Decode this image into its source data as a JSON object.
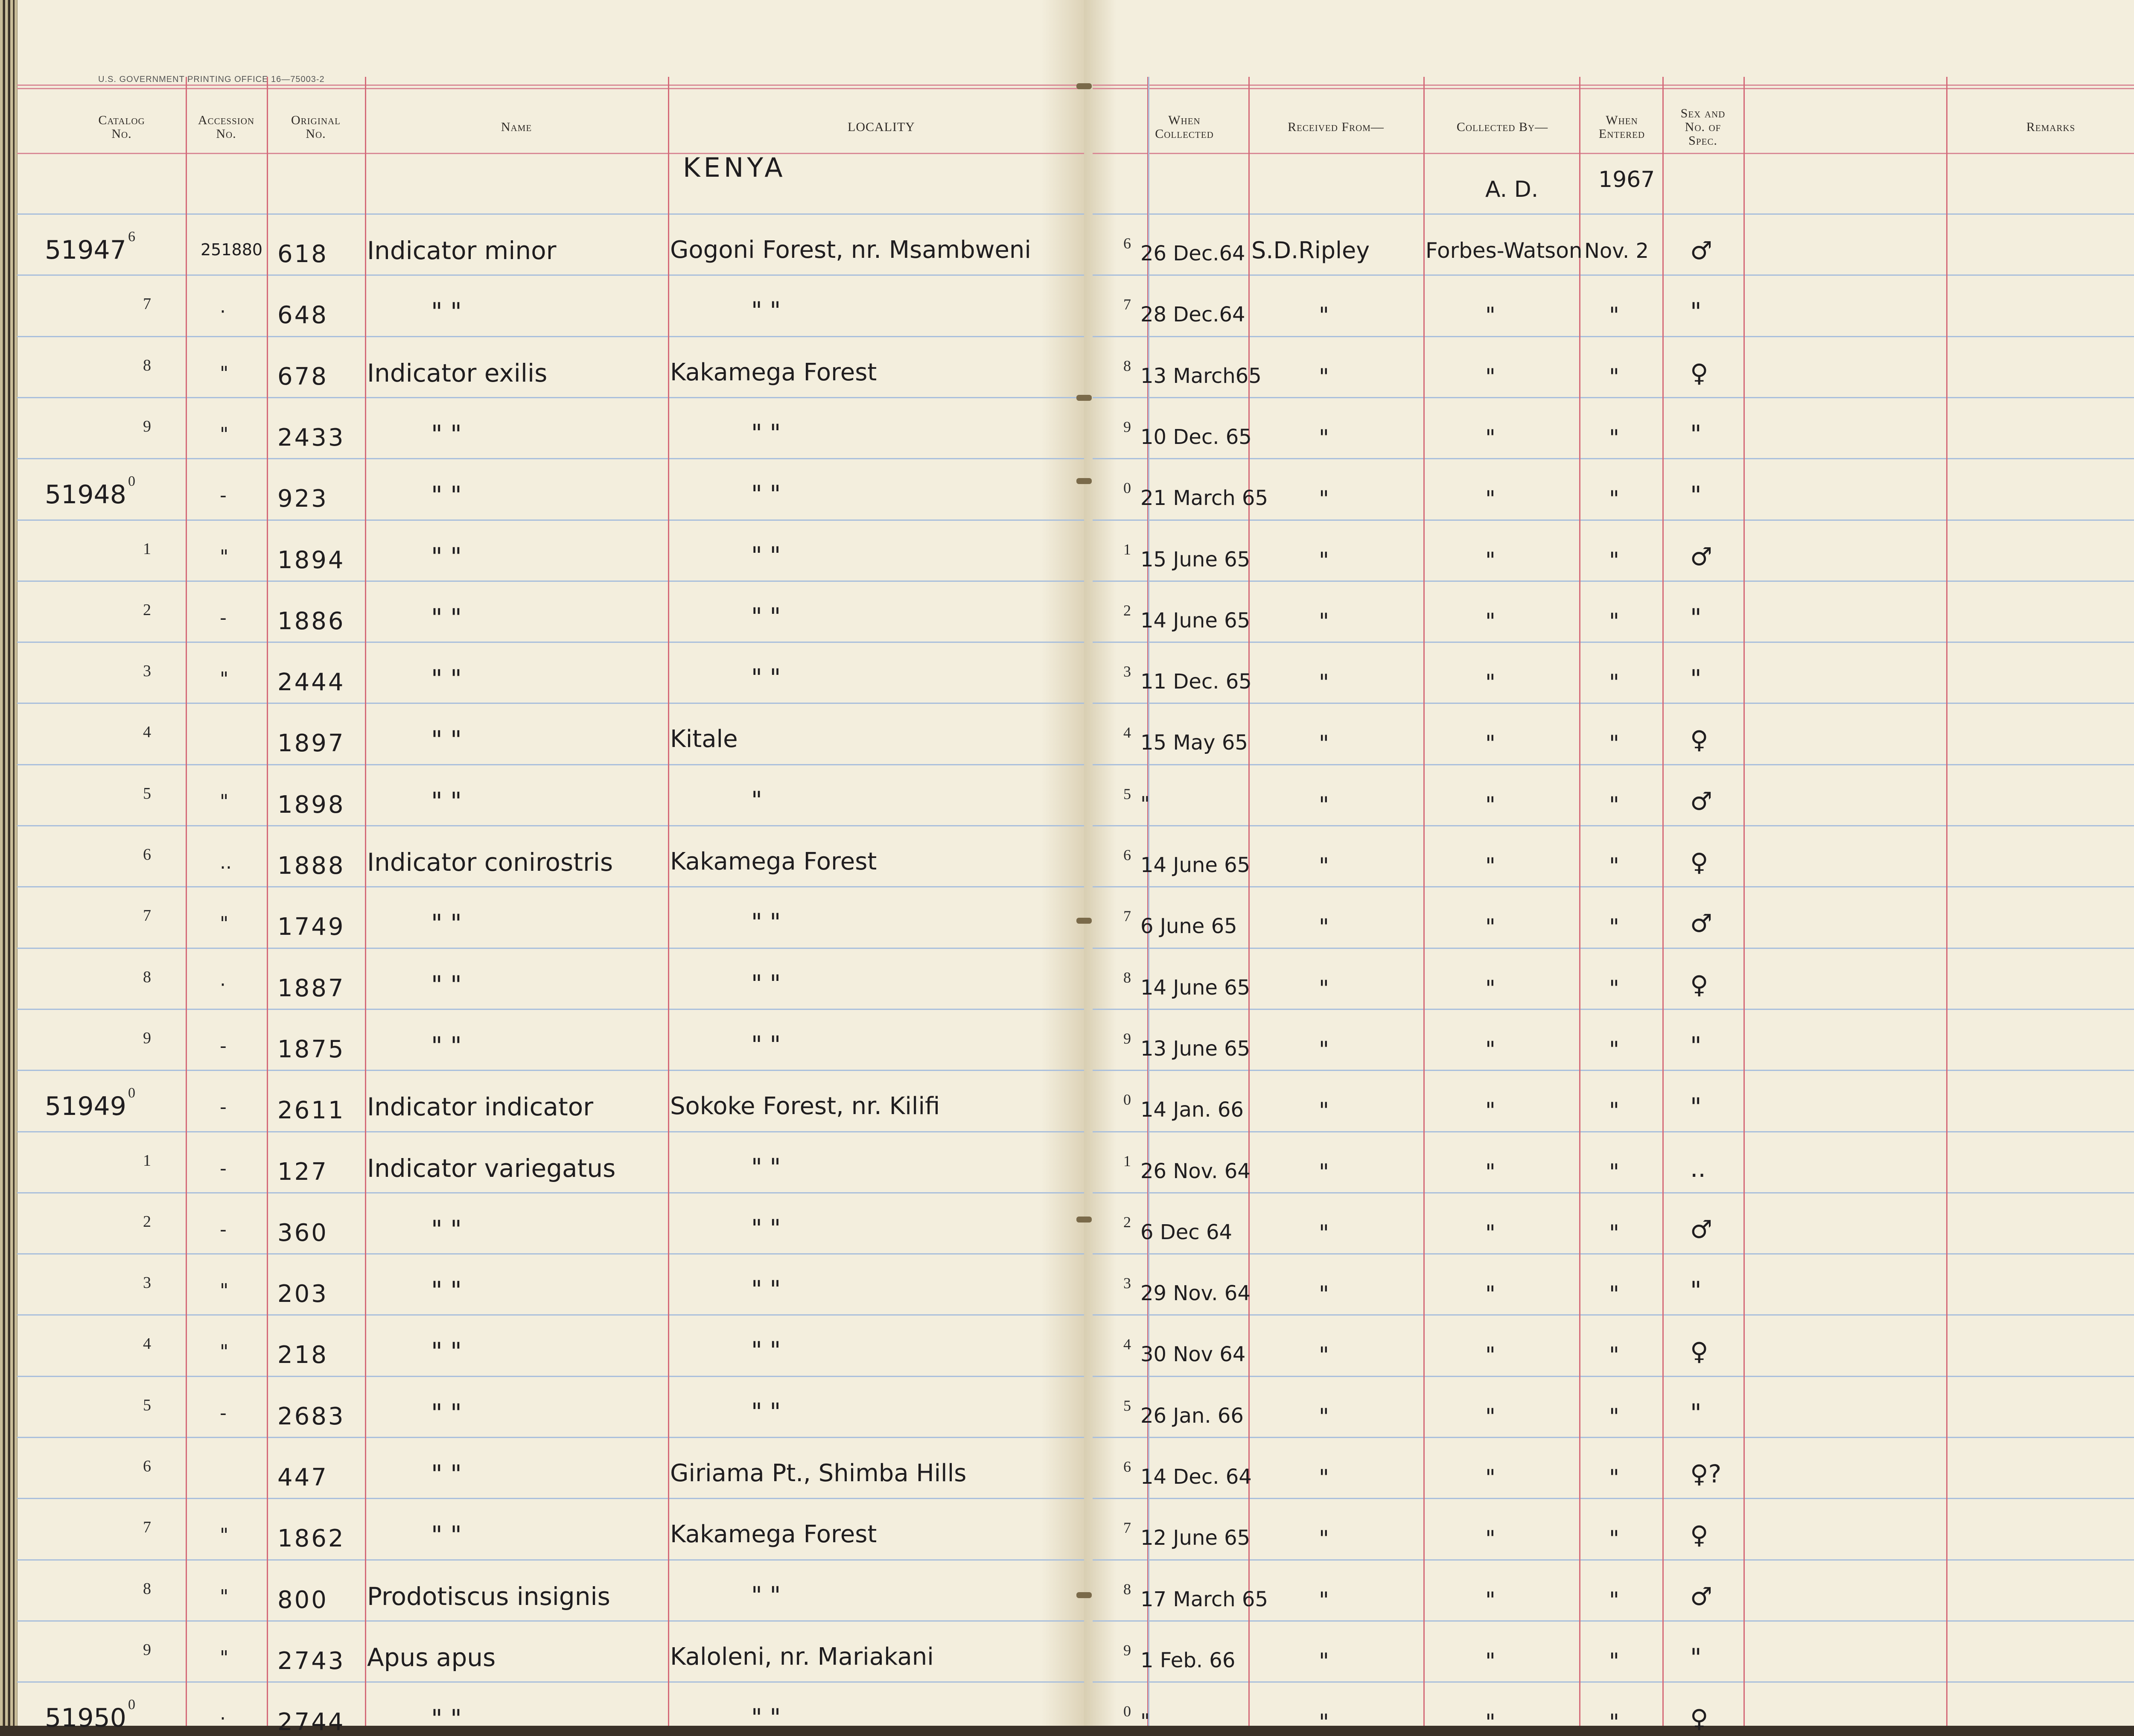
{
  "printer_line": "U.S. GOVERNMENT PRINTING OFFICE   16—75003-2",
  "headers": {
    "catalog": "Catalog\nNo.",
    "accession": "Accession\nNo.",
    "original": "Original\nNo.",
    "name": "Name",
    "locality": "LOCALITY",
    "when_collected": "When\nCollected",
    "received_from": "Received From—",
    "collected_by": "Collected By—",
    "when_entered": "When\nEntered",
    "sex_no": "Sex and\nNo. of\nSpec.",
    "remarks": "Remarks"
  },
  "locality_heading": "KENYA",
  "collected_by_heading": "A. D.",
  "entered_year_heading": "1967",
  "rows": [
    {
      "catalog": "51947",
      "digit": "6",
      "accession": "251880",
      "original": "618",
      "name": "Indicator minor",
      "locality": "Gogoni Forest, nr. Msambweni",
      "rdigit": "6",
      "when": "26 Dec.64",
      "received": "S.D.Ripley",
      "collected": "Forbes-Watson",
      "entered": "Nov. 2",
      "sex": "♂"
    },
    {
      "catalog": "",
      "digit": "7",
      "accession": "·",
      "original": "648",
      "name": "\"     \"",
      "locality": "\"          \"",
      "rdigit": "7",
      "when": "28 Dec.64",
      "received": "\"",
      "collected": "\"",
      "entered": "\"",
      "sex": "\""
    },
    {
      "catalog": "",
      "digit": "8",
      "accession": "\"",
      "original": "678",
      "name": "Indicator exilis",
      "locality": "Kakamega Forest",
      "rdigit": "8",
      "when": "13 March65",
      "received": "\"",
      "collected": "\"",
      "entered": "\"",
      "sex": "♀"
    },
    {
      "catalog": "",
      "digit": "9",
      "accession": "\"",
      "original": "2433",
      "name": "\"     \"",
      "locality": "\"     \"",
      "rdigit": "9",
      "when": "10 Dec. 65",
      "received": "\"",
      "collected": "\"",
      "entered": "\"",
      "sex": "\""
    },
    {
      "catalog": "51948",
      "digit": "0",
      "accession": "-",
      "original": "923",
      "name": "\"     \"",
      "locality": "\"     \"",
      "rdigit": "0",
      "when": "21 March 65",
      "received": "\"",
      "collected": "\"",
      "entered": "\"",
      "sex": "\""
    },
    {
      "catalog": "",
      "digit": "1",
      "accession": "\"",
      "original": "1894",
      "name": "\"     \"",
      "locality": "\"     \"",
      "rdigit": "1",
      "when": "15 June 65",
      "received": "\"",
      "collected": "\"",
      "entered": "\"",
      "sex": "♂"
    },
    {
      "catalog": "",
      "digit": "2",
      "accession": "-",
      "original": "1886",
      "name": "\"     \"",
      "locality": "\"     \"",
      "rdigit": "2",
      "when": "14 June 65",
      "received": "\"",
      "collected": "\"",
      "entered": "\"",
      "sex": "\""
    },
    {
      "catalog": "",
      "digit": "3",
      "accession": "\"",
      "original": "2444",
      "name": "\"     \"",
      "locality": "\"     \"",
      "rdigit": "3",
      "when": "11 Dec. 65",
      "received": "\"",
      "collected": "\"",
      "entered": "\"",
      "sex": "\""
    },
    {
      "catalog": "",
      "digit": "4",
      "accession": "",
      "original": "1897",
      "name": "\"     \"",
      "locality": "Kitale",
      "rdigit": "4",
      "when": "15 May 65",
      "received": "\"",
      "collected": "\"",
      "entered": "\"",
      "sex": "♀"
    },
    {
      "catalog": "",
      "digit": "5",
      "accession": "\"",
      "original": "1898",
      "name": "\"     \"",
      "locality": "\"",
      "rdigit": "5",
      "when": "\"",
      "received": "\"",
      "collected": "\"",
      "entered": "\"",
      "sex": "♂"
    },
    {
      "catalog": "",
      "digit": "6",
      "accession": "..",
      "original": "1888",
      "name": "Indicator conirostris",
      "locality": "Kakamega Forest",
      "rdigit": "6",
      "when": "14 June 65",
      "received": "\"",
      "collected": "\"",
      "entered": "\"",
      "sex": "♀"
    },
    {
      "catalog": "",
      "digit": "7",
      "accession": "\"",
      "original": "1749",
      "name": "\"     \"",
      "locality": "\"     \"",
      "rdigit": "7",
      "when": "6 June 65",
      "received": "\"",
      "collected": "\"",
      "entered": "\"",
      "sex": "♂"
    },
    {
      "catalog": "",
      "digit": "8",
      "accession": "·",
      "original": "1887",
      "name": "\"     \"",
      "locality": "\"     \"",
      "rdigit": "8",
      "when": "14 June 65",
      "received": "\"",
      "collected": "\"",
      "entered": "\"",
      "sex": "♀"
    },
    {
      "catalog": "",
      "digit": "9",
      "accession": "-",
      "original": "1875",
      "name": "\"     \"",
      "locality": "\"     \"",
      "rdigit": "9",
      "when": "13 June 65",
      "received": "\"",
      "collected": "\"",
      "entered": "\"",
      "sex": "\""
    },
    {
      "catalog": "51949",
      "digit": "0",
      "accession": "-",
      "original": "2611",
      "name": "Indicator indicator",
      "locality": "Sokoke Forest, nr. Kilifi",
      "rdigit": "0",
      "when": "14 Jan. 66",
      "received": "\"",
      "collected": "\"",
      "entered": "\"",
      "sex": "\""
    },
    {
      "catalog": "",
      "digit": "1",
      "accession": "-",
      "original": "127",
      "name": "Indicator variegatus",
      "locality": "\"     \"",
      "rdigit": "1",
      "when": "26 Nov. 64",
      "received": "\"",
      "collected": "\"",
      "entered": "\"",
      "sex": ".."
    },
    {
      "catalog": "",
      "digit": "2",
      "accession": "-",
      "original": "360",
      "name": "\"     \"",
      "locality": "\"     \"",
      "rdigit": "2",
      "when": "6 Dec 64",
      "received": "\"",
      "collected": "\"",
      "entered": "\"",
      "sex": "♂"
    },
    {
      "catalog": "",
      "digit": "3",
      "accession": "\"",
      "original": "203",
      "name": "\"     \"",
      "locality": "\"     \"",
      "rdigit": "3",
      "when": "29 Nov. 64",
      "received": "\"",
      "collected": "\"",
      "entered": "\"",
      "sex": "\""
    },
    {
      "catalog": "",
      "digit": "4",
      "accession": "\"",
      "original": "218",
      "name": "\"     \"",
      "locality": "\"     \"",
      "rdigit": "4",
      "when": "30 Nov 64",
      "received": "\"",
      "collected": "\"",
      "entered": "\"",
      "sex": "♀"
    },
    {
      "catalog": "",
      "digit": "5",
      "accession": "-",
      "original": "2683",
      "name": "\"     \"",
      "locality": "\"     \"",
      "rdigit": "5",
      "when": "26 Jan. 66",
      "received": "\"",
      "collected": "\"",
      "entered": "\"",
      "sex": "\""
    },
    {
      "catalog": "",
      "digit": "6",
      "accession": "",
      "original": "447",
      "name": "\"     \"",
      "locality": "Giriama Pt., Shimba Hills",
      "rdigit": "6",
      "when": "14 Dec. 64",
      "received": "\"",
      "collected": "\"",
      "entered": "\"",
      "sex": "♀?"
    },
    {
      "catalog": "",
      "digit": "7",
      "accession": "\"",
      "original": "1862",
      "name": "\"     \"",
      "locality": "Kakamega Forest",
      "rdigit": "7",
      "when": "12 June 65",
      "received": "\"",
      "collected": "\"",
      "entered": "\"",
      "sex": "♀"
    },
    {
      "catalog": "",
      "digit": "8",
      "accession": "\"",
      "original": "800",
      "name": "Prodotiscus insignis",
      "locality": "\"     \"",
      "rdigit": "8",
      "when": "17 March 65",
      "received": "\"",
      "collected": "\"",
      "entered": "\"",
      "sex": "♂"
    },
    {
      "catalog": "",
      "digit": "9",
      "accession": "\"",
      "original": "2743",
      "name": "Apus apus",
      "locality": "Kaloleni, nr. Mariakani",
      "rdigit": "9",
      "when": "1 Feb. 66",
      "received": "\"",
      "collected": "\"",
      "entered": "\"",
      "sex": "\""
    },
    {
      "catalog": "51950",
      "digit": "0",
      "accession": "·",
      "original": "2744",
      "name": "\"     \"",
      "locality": "\"     \"",
      "rdigit": "0",
      "when": "\"",
      "received": "\"",
      "collected": "\"",
      "entered": "\"",
      "sex": "♀"
    }
  ]
}
